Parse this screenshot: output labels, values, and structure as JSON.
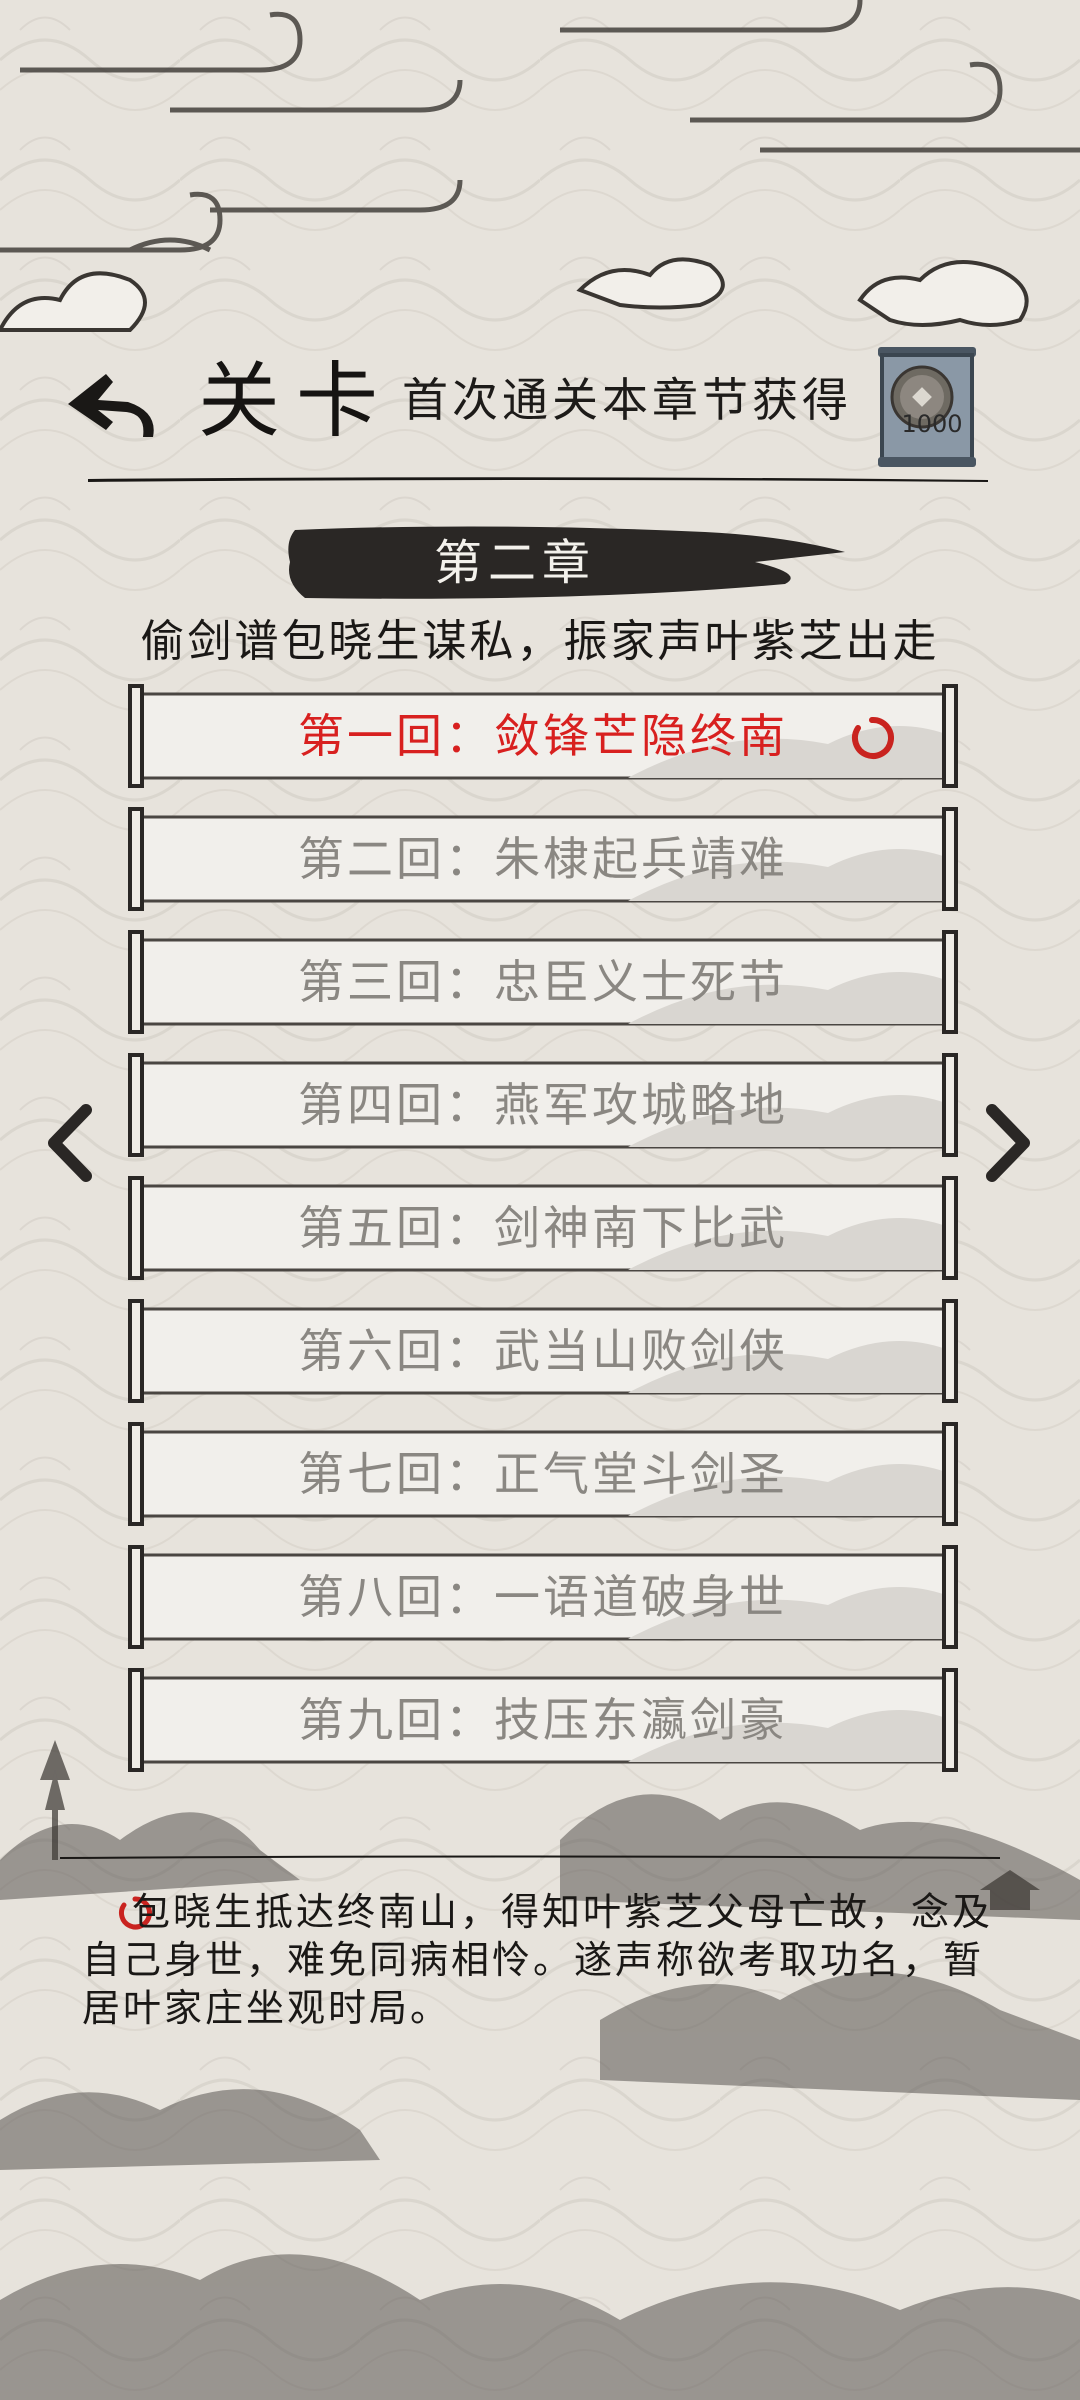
{
  "header": {
    "title": "关卡",
    "reward_text": "首次通关本章节获得",
    "reward_amount": "1000",
    "reward_icon": "coin-scroll-icon",
    "back_icon": "back-arrow-icon"
  },
  "chapter": {
    "name": "第二章",
    "subtitle": "偷剑谱包晓生谋私，振家声叶紫芝出走"
  },
  "levels": [
    {
      "label": "第一回：敛锋芒隐终南",
      "status": "current"
    },
    {
      "label": "第二回：朱棣起兵靖难",
      "status": "locked"
    },
    {
      "label": "第三回：忠臣义士死节",
      "status": "locked"
    },
    {
      "label": "第四回：燕军攻城略地",
      "status": "locked"
    },
    {
      "label": "第五回：剑神南下比武",
      "status": "locked"
    },
    {
      "label": "第六回：武当山败剑侠",
      "status": "locked"
    },
    {
      "label": "第七回：正气堂斗剑圣",
      "status": "locked"
    },
    {
      "label": "第八回：一语道破身世",
      "status": "locked"
    },
    {
      "label": "第九回：技压东瀛剑豪",
      "status": "locked"
    }
  ],
  "description": "包晓生抵达终南山，得知叶紫芝父母亡故，念及自己身世，难免同病相怜。遂声称欲考取功名，暂居叶家庄坐观时局。",
  "colors": {
    "current_level": "#d8201f",
    "locked_level": "#8a8782",
    "background": "#e7e3dc"
  }
}
